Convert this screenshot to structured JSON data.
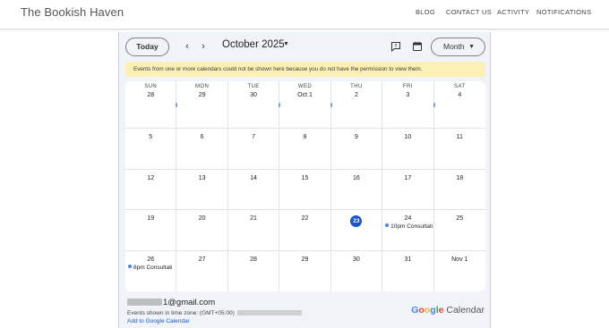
{
  "site": {
    "title": "The Bookish Haven",
    "nav": [
      "BLOG",
      "CONTACT US",
      "ACTIVITY",
      "NOTIFICATIONS"
    ]
  },
  "calendar": {
    "today_label": "Today",
    "prev_icon": "chevron-left-icon",
    "next_icon": "chevron-right-icon",
    "month_title": "October 2025",
    "view_label": "Month",
    "warning": "Events from one or more calendars could not be shown here because you do not have the permission to view them.",
    "weekdays": [
      "SUN",
      "MON",
      "TUE",
      "WED",
      "THU",
      "FRI",
      "SAT"
    ],
    "weeks": [
      [
        "28",
        "29",
        "30",
        "Oct 1",
        "2",
        "3",
        "4"
      ],
      [
        "5",
        "6",
        "7",
        "8",
        "9",
        "10",
        "11"
      ],
      [
        "12",
        "13",
        "14",
        "15",
        "16",
        "17",
        "18"
      ],
      [
        "19",
        "20",
        "21",
        "22",
        "23",
        "24",
        "25"
      ],
      [
        "26",
        "27",
        "28",
        "29",
        "30",
        "31",
        "Nov 1"
      ]
    ],
    "today": "23",
    "events": [
      {
        "week": 3,
        "day": 5,
        "label": "10pm Consultati"
      },
      {
        "week": 4,
        "day": 0,
        "label": "8pm Consultati"
      }
    ],
    "colors": {
      "accent": "#1a56c9",
      "event_dot": "#4285f4",
      "warning_bg": "#fbf1b5",
      "embed_bg": "#f0f4f9"
    }
  },
  "footer": {
    "email_suffix": "1@gmail.com",
    "timezone_label": "Events shown in time zone: (GMT+05:00)",
    "add_link": "Add to Google Calendar",
    "brand_letters": [
      "G",
      "o",
      "o",
      "g",
      "l",
      "e"
    ],
    "brand_colors": [
      "#4285f4",
      "#ea4335",
      "#fbbc05",
      "#4285f4",
      "#34a853",
      "#ea4335"
    ],
    "brand_suffix": "Calendar"
  }
}
